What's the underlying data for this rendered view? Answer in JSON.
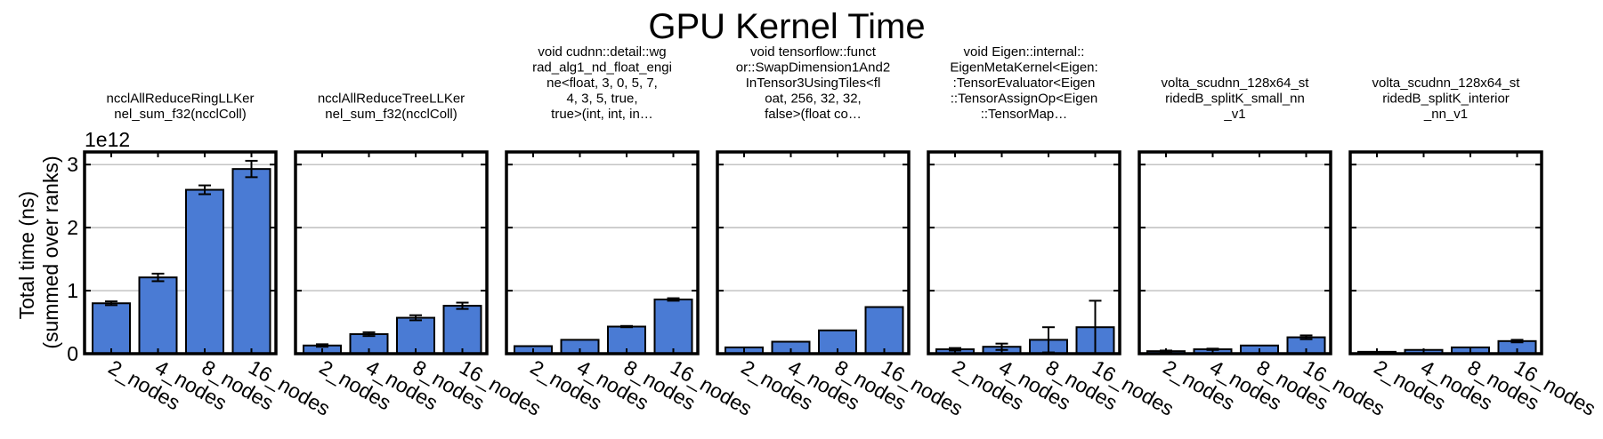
{
  "figure": {
    "title": "GPU Kernel Time",
    "ylabel_lines": [
      "Total time (ns)",
      "(summed over ranks)"
    ],
    "sci_multiplier": "1e12"
  },
  "colors": {
    "bar_fill": "#4a7bd4",
    "bar_edge": "#000000",
    "grid": "#b0b0b0",
    "axes": "#000000"
  },
  "chart_data": [
    {
      "type": "bar",
      "title_lines": [
        "ncclAllReduceRingLLKer",
        "nel_sum_f32(ncclColl)"
      ],
      "categories": [
        "2_nodes",
        "4_nodes",
        "8_nodes",
        "16_nodes"
      ],
      "values": [
        0.8,
        1.21,
        2.6,
        2.93
      ],
      "errors": [
        0.03,
        0.06,
        0.07,
        0.13
      ],
      "ylim": [
        0,
        3.2
      ],
      "yticks": [
        0,
        1,
        2,
        3
      ],
      "grid": true,
      "show_yticks": true
    },
    {
      "type": "bar",
      "title_lines": [
        "ncclAllReduceTreeLLKer",
        "nel_sum_f32(ncclColl)"
      ],
      "categories": [
        "2_nodes",
        "4_nodes",
        "8_nodes",
        "16_nodes"
      ],
      "values": [
        0.13,
        0.31,
        0.57,
        0.76
      ],
      "errors": [
        0.02,
        0.03,
        0.04,
        0.05
      ],
      "ylim": [
        0,
        3.2
      ],
      "yticks": [
        0,
        1,
        2,
        3
      ],
      "grid": true,
      "show_yticks": false
    },
    {
      "type": "bar",
      "title_lines": [
        "void cudnn::detail::wg",
        "rad_alg1_nd_float_engi",
        "ne<float, 3, 0, 5, 7,",
        "4, 3, 5, true,",
        "true>(int, int, in…"
      ],
      "categories": [
        "2_nodes",
        "4_nodes",
        "8_nodes",
        "16_nodes"
      ],
      "values": [
        0.12,
        0.22,
        0.43,
        0.86
      ],
      "errors": [
        0.0,
        0.0,
        0.01,
        0.02
      ],
      "ylim": [
        0,
        3.2
      ],
      "yticks": [
        0,
        1,
        2,
        3
      ],
      "grid": true,
      "show_yticks": false
    },
    {
      "type": "bar",
      "title_lines": [
        "void tensorflow::funct",
        "or::SwapDimension1And2",
        "InTensor3UsingTiles<fl",
        "oat, 256, 32, 32,",
        "false>(float co…"
      ],
      "categories": [
        "2_nodes",
        "4_nodes",
        "8_nodes",
        "16_nodes"
      ],
      "values": [
        0.1,
        0.19,
        0.37,
        0.74
      ],
      "errors": [
        0.0,
        0.0,
        0.0,
        0.0
      ],
      "ylim": [
        0,
        3.2
      ],
      "yticks": [
        0,
        1,
        2,
        3
      ],
      "grid": true,
      "show_yticks": false
    },
    {
      "type": "bar",
      "title_lines": [
        "void Eigen::internal::",
        "EigenMetaKernel<Eigen:",
        ":TensorEvaluator<Eigen",
        "::TensorAssignOp<Eigen",
        "::TensorMap…"
      ],
      "categories": [
        "2_nodes",
        "4_nodes",
        "8_nodes",
        "16_nodes"
      ],
      "values": [
        0.07,
        0.11,
        0.22,
        0.42
      ],
      "errors": [
        0.02,
        0.05,
        0.2,
        0.42
      ],
      "ylim": [
        0,
        3.2
      ],
      "yticks": [
        0,
        1,
        2,
        3
      ],
      "grid": true,
      "show_yticks": false
    },
    {
      "type": "bar",
      "title_lines": [
        "volta_scudnn_128x64_st",
        "ridedB_splitK_small_nn",
        "_v1"
      ],
      "categories": [
        "2_nodes",
        "4_nodes",
        "8_nodes",
        "16_nodes"
      ],
      "values": [
        0.04,
        0.07,
        0.13,
        0.26
      ],
      "errors": [
        0.01,
        0.01,
        0.0,
        0.03
      ],
      "ylim": [
        0,
        3.2
      ],
      "yticks": [
        0,
        1,
        2,
        3
      ],
      "grid": true,
      "show_yticks": false
    },
    {
      "type": "bar",
      "title_lines": [
        "volta_scudnn_128x64_st",
        "ridedB_splitK_interior",
        "_nn_v1"
      ],
      "categories": [
        "2_nodes",
        "4_nodes",
        "8_nodes",
        "16_nodes"
      ],
      "values": [
        0.03,
        0.06,
        0.1,
        0.2
      ],
      "errors": [
        0.0,
        0.0,
        0.0,
        0.02
      ],
      "ylim": [
        0,
        3.2
      ],
      "yticks": [
        0,
        1,
        2,
        3
      ],
      "grid": true,
      "show_yticks": false
    }
  ]
}
